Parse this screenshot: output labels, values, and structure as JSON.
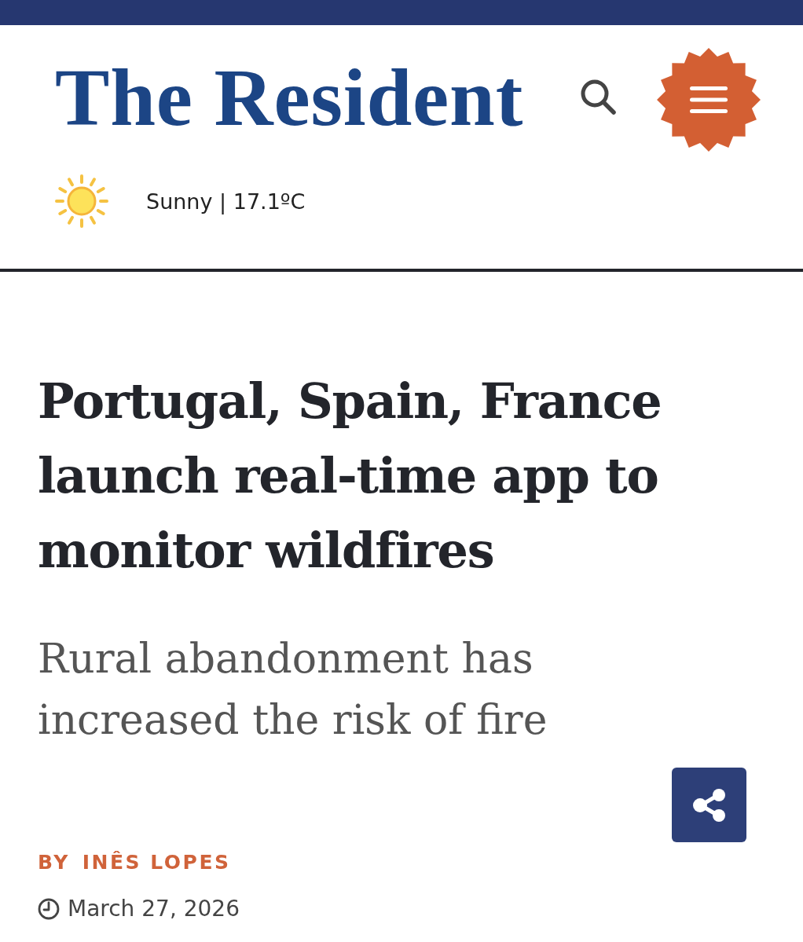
{
  "masthead": {
    "logo": "The Resident"
  },
  "weather": {
    "condition": "Sunny | 17.1ºC"
  },
  "article": {
    "headline": "Portugal, Spain, France launch real-time app to monitor wildfires",
    "subheadline": "Rural abandonment has increased the risk of fire",
    "byline_label": "BY",
    "author": "INÊS LOPES",
    "date": "March 27, 2026"
  }
}
